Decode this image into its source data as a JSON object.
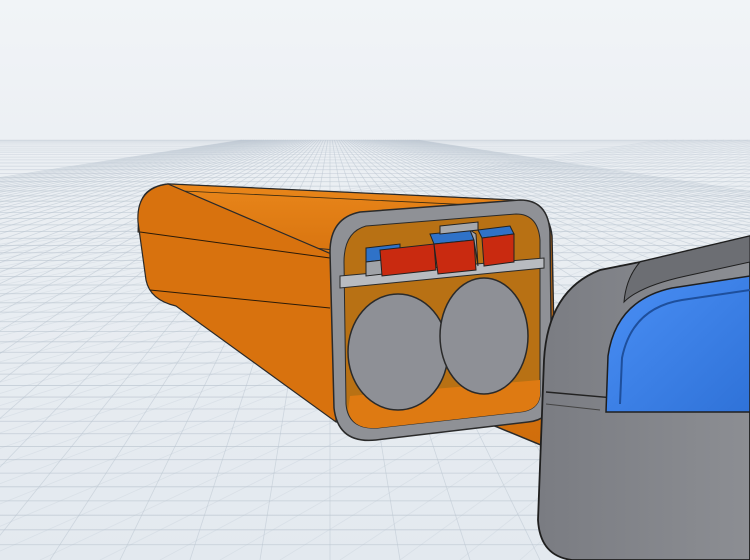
{
  "scene": {
    "background_color": "#e8edf2",
    "grid_color": "#b9c4cf",
    "objects": [
      {
        "name": "battery-housing",
        "color": "#e07a12"
      },
      {
        "name": "inner-shell",
        "color": "#8f9196"
      },
      {
        "name": "cylindrical-cell",
        "count": 2,
        "color": "#8e9096"
      },
      {
        "name": "pcb-board",
        "color": "#b8bbc0"
      },
      {
        "name": "smd-component",
        "count": 3,
        "top_color": "#2f72c8",
        "side_color": "#c92a10"
      },
      {
        "name": "end-cap",
        "color": "#7f8187",
        "accent_color": "#3b82f0"
      }
    ]
  }
}
